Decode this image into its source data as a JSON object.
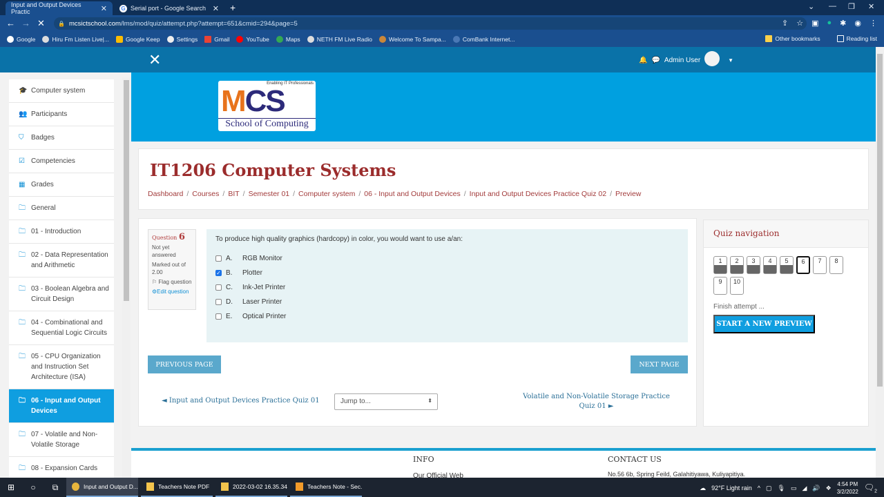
{
  "browser": {
    "tabs": [
      {
        "title": "Input and Output Devices Practic",
        "active": true
      },
      {
        "title": "Serial port - Google Search",
        "active": false
      }
    ],
    "url_host": "mcsictschool.com",
    "url_path": "/lms/mod/quiz/attempt.php?attempt=651&cmid=294&page=5",
    "bookmarks": [
      "Google",
      "Hiru Fm Listen Live|...",
      "Google Keep",
      "Settings",
      "Gmail",
      "YouTube",
      "Maps",
      "NETH FM Live Radio",
      "Welcome To Sampa...",
      "ComBank Internet..."
    ],
    "other_bookmarks": "Other bookmarks",
    "reading_list": "Reading list"
  },
  "navbar": {
    "user_name": "Admin User"
  },
  "logo": {
    "tagline": "Enabling IT Professionals",
    "m": "M",
    "cs": "CS",
    "school": "School of Computing"
  },
  "sidebar": {
    "items": [
      {
        "label": "Computer system",
        "icon": "graduation-cap-icon",
        "glyph": "🎓"
      },
      {
        "label": "Participants",
        "icon": "users-icon",
        "glyph": "👥"
      },
      {
        "label": "Badges",
        "icon": "shield-icon",
        "glyph": "⛉"
      },
      {
        "label": "Competencies",
        "icon": "checkbox-icon",
        "glyph": "☑"
      },
      {
        "label": "Grades",
        "icon": "table-icon",
        "glyph": "▦"
      },
      {
        "label": "General",
        "icon": "folder-icon",
        "glyph": "🗀"
      },
      {
        "label": "01 - Introduction",
        "icon": "folder-icon",
        "glyph": "🗀"
      },
      {
        "label": "02 - Data Representation and Arithmetic",
        "icon": "folder-icon",
        "glyph": "🗀"
      },
      {
        "label": "03 - Boolean Algebra and Circuit Design",
        "icon": "folder-icon",
        "glyph": "🗀"
      },
      {
        "label": "04 - Combinational and Sequential Logic Circuits",
        "icon": "folder-icon",
        "glyph": "🗀"
      },
      {
        "label": "05 - CPU Organization and Instruction Set Architecture (ISA)",
        "icon": "folder-icon",
        "glyph": "🗀"
      },
      {
        "label": "06 - Input and Output Devices",
        "icon": "folder-icon",
        "glyph": "🗀",
        "active": true
      },
      {
        "label": "07 - Volatile and Non-Volatile Storage",
        "icon": "folder-icon",
        "glyph": "🗀"
      },
      {
        "label": "08 - Expansion Cards",
        "icon": "folder-icon",
        "glyph": "🗀"
      }
    ]
  },
  "page": {
    "title": "IT1206 Computer Systems",
    "breadcrumb": [
      "Dashboard",
      "Courses",
      "BIT",
      "Semester 01",
      "Computer system",
      "06 - Input and Output Devices",
      "Input and Output Devices Practice Quiz 02",
      "Preview"
    ]
  },
  "question": {
    "label": "Question",
    "number": "6",
    "status": "Not yet answered",
    "marked": "Marked out of 2.00",
    "flag": "Flag question",
    "edit": "Edit question",
    "text": "To produce high quality graphics (hardcopy) in color, you would want to use a/an:",
    "options": [
      {
        "letter": "A.",
        "text": "RGB Monitor",
        "checked": false
      },
      {
        "letter": "B.",
        "text": "Plotter",
        "checked": true
      },
      {
        "letter": "C.",
        "text": "Ink-Jet Printer",
        "checked": false
      },
      {
        "letter": "D.",
        "text": "Laser Printer",
        "checked": false
      },
      {
        "letter": "E.",
        "text": "Optical Printer",
        "checked": false
      }
    ]
  },
  "nav_buttons": {
    "previous": "PREVIOUS PAGE",
    "next": "NEXT PAGE",
    "prev_activity": "◄ Input and Output Devices Practice Quiz 01",
    "jump": "Jump to...",
    "next_activity": "Volatile and Non-Volatile Storage Practice Quiz 01 ►"
  },
  "quiz_nav": {
    "title": "Quiz navigation",
    "questions": [
      {
        "n": "1",
        "state": "answered"
      },
      {
        "n": "2",
        "state": "answered"
      },
      {
        "n": "3",
        "state": "answered"
      },
      {
        "n": "4",
        "state": "answered"
      },
      {
        "n": "5",
        "state": "answered"
      },
      {
        "n": "6",
        "state": "current"
      },
      {
        "n": "7",
        "state": "unanswered"
      },
      {
        "n": "8",
        "state": "unanswered"
      },
      {
        "n": "9",
        "state": "unanswered"
      },
      {
        "n": "10",
        "state": "unanswered"
      }
    ],
    "finish": "Finish attempt ...",
    "start_new": "START A NEW PREVIEW"
  },
  "footer": {
    "info": "INFO",
    "web": "Our Official Web",
    "contact": "CONTACT US",
    "address": "No.56 6b, Spring Feild, Galahitiyawa, Kuliyapitiya."
  },
  "taskbar": {
    "apps": [
      "Input and Output D...",
      "Teachers Note PDF",
      "2022-03-02 16.35.34...",
      "Teachers Note - Sec..."
    ],
    "weather": "92°F  Light rain",
    "time": "4:54 PM",
    "date": "3/2/2022",
    "notifications": "2"
  },
  "colors": {
    "accent": "#0f9ee0",
    "navbar": "#0a72a8",
    "title": "#9b2c2c"
  }
}
